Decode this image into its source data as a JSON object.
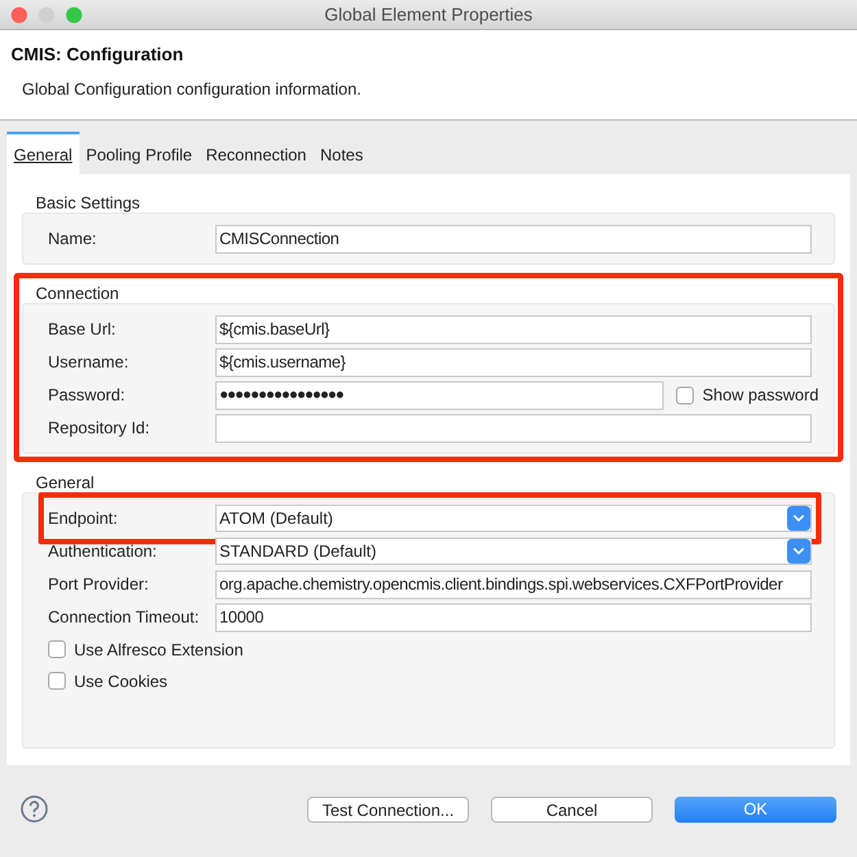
{
  "window": {
    "title": "Global Element Properties"
  },
  "header": {
    "title": "CMIS: Configuration",
    "description": "Global Configuration configuration information."
  },
  "tabs": [
    {
      "label": "General",
      "selected": true
    },
    {
      "label": "Pooling Profile",
      "selected": false
    },
    {
      "label": "Reconnection",
      "selected": false
    },
    {
      "label": "Notes",
      "selected": false
    }
  ],
  "sections": [
    {
      "title": "Basic Settings",
      "highlighted": false,
      "fields": [
        {
          "kind": "text",
          "label": "Name:",
          "value": "CMISConnection",
          "highlighted": false
        }
      ]
    },
    {
      "title": "Connection",
      "highlighted": true,
      "fields": [
        {
          "kind": "text",
          "label": "Base Url:",
          "value": "${cmis.baseUrl}",
          "highlighted": false
        },
        {
          "kind": "text",
          "label": "Username:",
          "value": "${cmis.username}",
          "highlighted": false
        },
        {
          "kind": "password",
          "label": "Password:",
          "value": "●●●●●●●●●●●●●●●●",
          "highlighted": false,
          "toggle": {
            "label": "Show password",
            "checked": false
          }
        },
        {
          "kind": "text",
          "label": "Repository Id:",
          "highlighted": false
        }
      ]
    },
    {
      "title": "General",
      "highlighted": false,
      "fields": [
        {
          "kind": "select",
          "label": "Endpoint:",
          "value": "ATOM (Default)",
          "highlighted": true
        },
        {
          "kind": "select",
          "label": "Authentication:",
          "value": "STANDARD (Default)",
          "highlighted": false
        },
        {
          "kind": "text",
          "label": "Port Provider:",
          "value": "org.apache.chemistry.opencmis.client.bindings.spi.webservices.CXFPortProvider",
          "highlighted": false
        },
        {
          "kind": "text",
          "label": "Connection Timeout:",
          "value": "10000",
          "highlighted": false
        },
        {
          "kind": "checkbox",
          "label": "Use Alfresco Extension",
          "checked": false,
          "highlighted": false
        },
        {
          "kind": "checkbox",
          "label": "Use Cookies",
          "checked": false,
          "highlighted": false
        }
      ]
    }
  ],
  "buttons": [
    {
      "label": "Test Connection...",
      "primary": false
    },
    {
      "label": "Cancel",
      "primary": false
    },
    {
      "label": "OK",
      "primary": true
    }
  ]
}
